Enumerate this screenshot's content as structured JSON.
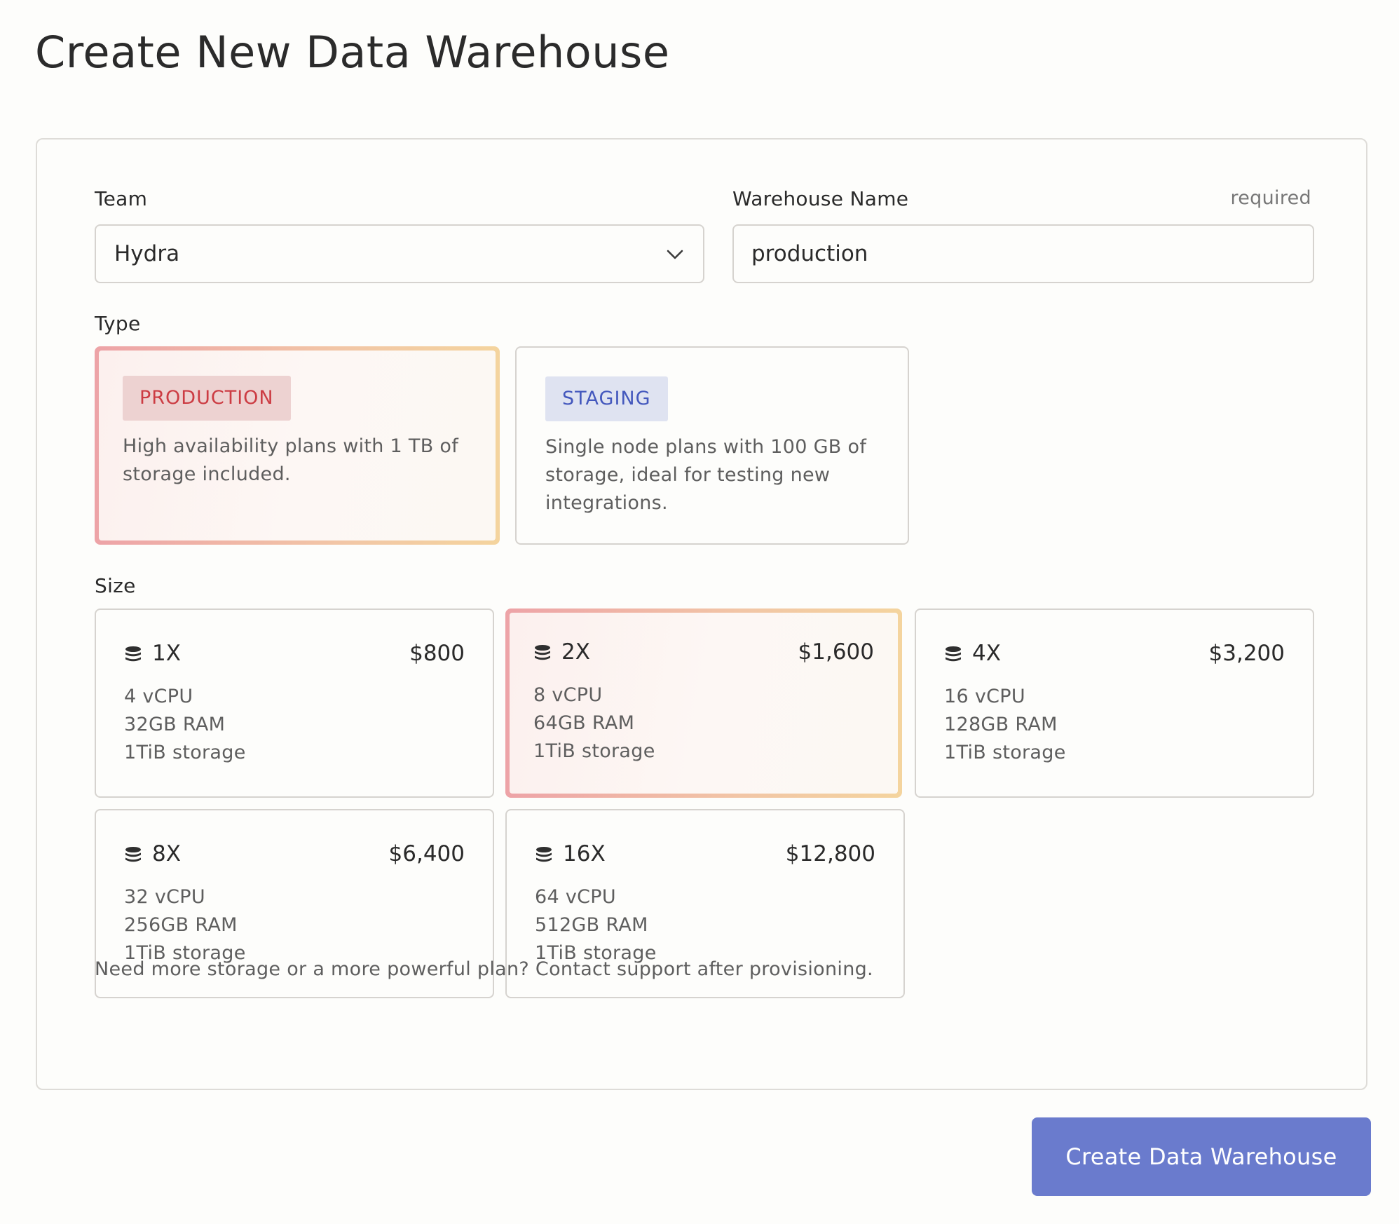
{
  "page": {
    "title": "Create New Data Warehouse"
  },
  "form": {
    "team": {
      "label": "Team",
      "value": "Hydra"
    },
    "warehouse_name": {
      "label": "Warehouse Name",
      "hint": "required",
      "value": "production"
    },
    "type": {
      "label": "Type",
      "options": [
        {
          "badge": "PRODUCTION",
          "description_lines": [
            "High availability plans with 1 TB of",
            "storage included."
          ],
          "selected": true
        },
        {
          "badge": "STAGING",
          "description_lines": [
            "Single node plans with 100 GB of",
            "storage, ideal for testing new",
            "integrations."
          ],
          "selected": false
        }
      ]
    },
    "size": {
      "label": "Size",
      "options": [
        {
          "name": "1X",
          "price": "$800",
          "cpu": "4 vCPU",
          "ram": "32GB RAM",
          "storage": "1TiB storage",
          "selected": false
        },
        {
          "name": "2X",
          "price": "$1,600",
          "cpu": "8 vCPU",
          "ram": "64GB RAM",
          "storage": "1TiB storage",
          "selected": true
        },
        {
          "name": "4X",
          "price": "$3,200",
          "cpu": "16 vCPU",
          "ram": "128GB RAM",
          "storage": "1TiB storage",
          "selected": false
        },
        {
          "name": "8X",
          "price": "$6,400",
          "cpu": "32 vCPU",
          "ram": "256GB RAM",
          "storage": "1TiB storage",
          "selected": false
        },
        {
          "name": "16X",
          "price": "$12,800",
          "cpu": "64 vCPU",
          "ram": "512GB RAM",
          "storage": "1TiB storage",
          "selected": false
        }
      ]
    },
    "footer_note": "Need more storage or a more powerful plan? Contact support after provisioning."
  },
  "actions": {
    "submit_label": "Create Data Warehouse"
  },
  "icons": {
    "team_select": "chevron-down-icon",
    "size_option": "database-icon"
  },
  "colors": {
    "primary_button": "#6a7bcd",
    "production_badge_text": "#cc3c43",
    "staging_badge_text": "#4458bd",
    "selected_border_start": "#eda3a7",
    "selected_border_end": "#f4d49e"
  }
}
